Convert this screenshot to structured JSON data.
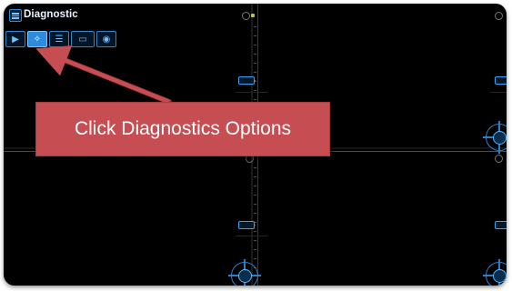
{
  "app": {
    "title": "Diagnostic",
    "menu_icon": "hamburger-menu-icon"
  },
  "toolbar": {
    "buttons": [
      {
        "name": "play-icon",
        "active": false
      },
      {
        "name": "diagnostics-options-icon",
        "active": true
      },
      {
        "name": "sliders-icon",
        "active": false
      },
      {
        "name": "chip-icon",
        "active": false
      },
      {
        "name": "location-pin-icon",
        "active": false
      }
    ]
  },
  "callout": {
    "text": "Click Diagnostics Options"
  },
  "colors": {
    "background": "#000000",
    "accent": "#2a8be0",
    "callout": "#c64d51",
    "arrow": "#c64d51"
  }
}
